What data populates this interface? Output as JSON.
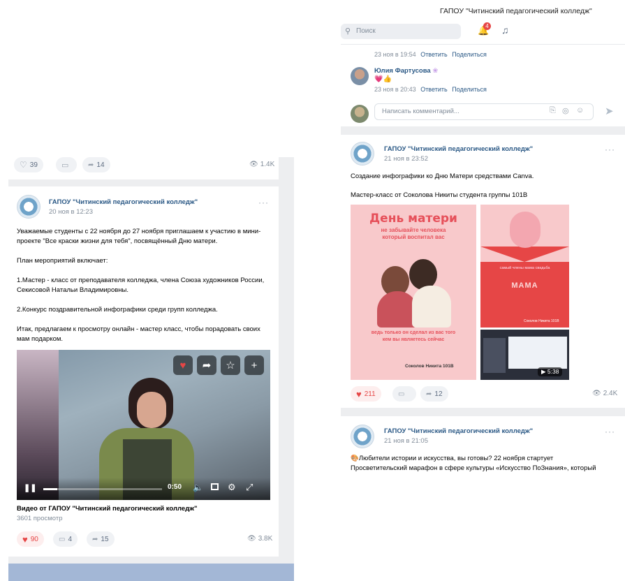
{
  "left": {
    "top_actions": {
      "likes": "39",
      "shares": "14",
      "views": "1.4K"
    },
    "post": {
      "group": "ГАПОУ \"Читинский педагогический колледж\"",
      "date": "20 ноя в 12:23",
      "text_lines": [
        "Уважаемые студенты с 22 ноября до 27 ноября приглашаем к участию в мини-",
        "проекте \"Все краски жизни для тебя\", посвящённый Дню матери.",
        "",
        "План мероприятий включает:",
        "",
        "1.Мастер - класс от преподавателя колледжа, члена Союза художников России,",
        "Секисовой Натальи Владимировны.",
        "",
        "2.Конкурс поздравительной инфографики среди групп колледжа.",
        "",
        "Итак, предлагаем к просмотру онлайн - мастер класс, чтобы порадовать своих",
        "мам подарком."
      ],
      "video_time": "0:50",
      "video_progress": 0.12,
      "video_title": "Видео от ГАПОУ \"Читинский педагогический колледж\"",
      "video_views": "3601 просмотр",
      "likes": "90",
      "comments": "4",
      "shares": "15",
      "views": "3.8K"
    }
  },
  "right": {
    "header_title": "ГАПОУ \"Читинский педагогический колледж\"",
    "search_placeholder": "Поиск",
    "notif_count": "4",
    "comment_meta1": {
      "date": "23 ноя в 19:54",
      "reply": "Ответить",
      "share": "Поделиться"
    },
    "comment": {
      "author": "Юлия Фартусова",
      "emoji": "💗👍",
      "date": "23 ноя в 20:43",
      "reply": "Ответить",
      "share": "Поделиться"
    },
    "write_placeholder": "Написать комментарий...",
    "post1": {
      "group": "ГАПОУ \"Читинский педагогический колледж\"",
      "date": "21 ноя в 23:52",
      "text1": "Создание инфографики ко Дню Матери средствами Canva.",
      "text2": "Мастер-класс от Соколова Никиты студента группы 101В",
      "img1_title": "День матери",
      "img1_sub1": "не забывайте человека",
      "img1_sub2": "который воспитал вас",
      "img1_bottom1": "ведь только он сделал из вас того",
      "img1_bottom2": "кем вы являетесь сейчас",
      "img1_author": "Соколов Никита 101В",
      "img2_caption": "самый члены мама свадьба",
      "img2_mama": "МАМА",
      "img2_author": "Соколов Никита 101В",
      "video_duration": "5:38",
      "likes": "211",
      "shares": "12",
      "views": "2.4K"
    },
    "post2": {
      "group": "ГАПОУ \"Читинский педагогический колледж\"",
      "date": "21 ноя в 21:05",
      "line1": "Любители истории и искусства, вы готовы? 22 ноября стартует",
      "line2": "Просветительский марафон в сфере культуры «Искусство ПоЗнания», который"
    }
  },
  "colors": {
    "like_red": "#e64646",
    "link": "#2a5885",
    "pink_card": "#f8c9cb",
    "red_card": "#e64646"
  }
}
